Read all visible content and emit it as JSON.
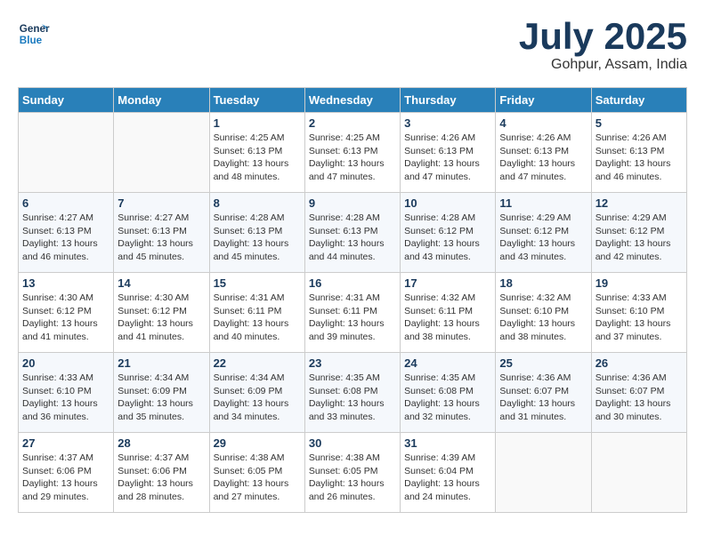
{
  "header": {
    "logo_line1": "General",
    "logo_line2": "Blue",
    "month": "July 2025",
    "location": "Gohpur, Assam, India"
  },
  "days_of_week": [
    "Sunday",
    "Monday",
    "Tuesday",
    "Wednesday",
    "Thursday",
    "Friday",
    "Saturday"
  ],
  "weeks": [
    [
      {
        "day": "",
        "detail": ""
      },
      {
        "day": "",
        "detail": ""
      },
      {
        "day": "1",
        "detail": "Sunrise: 4:25 AM\nSunset: 6:13 PM\nDaylight: 13 hours and 48 minutes."
      },
      {
        "day": "2",
        "detail": "Sunrise: 4:25 AM\nSunset: 6:13 PM\nDaylight: 13 hours and 47 minutes."
      },
      {
        "day": "3",
        "detail": "Sunrise: 4:26 AM\nSunset: 6:13 PM\nDaylight: 13 hours and 47 minutes."
      },
      {
        "day": "4",
        "detail": "Sunrise: 4:26 AM\nSunset: 6:13 PM\nDaylight: 13 hours and 47 minutes."
      },
      {
        "day": "5",
        "detail": "Sunrise: 4:26 AM\nSunset: 6:13 PM\nDaylight: 13 hours and 46 minutes."
      }
    ],
    [
      {
        "day": "6",
        "detail": "Sunrise: 4:27 AM\nSunset: 6:13 PM\nDaylight: 13 hours and 46 minutes."
      },
      {
        "day": "7",
        "detail": "Sunrise: 4:27 AM\nSunset: 6:13 PM\nDaylight: 13 hours and 45 minutes."
      },
      {
        "day": "8",
        "detail": "Sunrise: 4:28 AM\nSunset: 6:13 PM\nDaylight: 13 hours and 45 minutes."
      },
      {
        "day": "9",
        "detail": "Sunrise: 4:28 AM\nSunset: 6:13 PM\nDaylight: 13 hours and 44 minutes."
      },
      {
        "day": "10",
        "detail": "Sunrise: 4:28 AM\nSunset: 6:12 PM\nDaylight: 13 hours and 43 minutes."
      },
      {
        "day": "11",
        "detail": "Sunrise: 4:29 AM\nSunset: 6:12 PM\nDaylight: 13 hours and 43 minutes."
      },
      {
        "day": "12",
        "detail": "Sunrise: 4:29 AM\nSunset: 6:12 PM\nDaylight: 13 hours and 42 minutes."
      }
    ],
    [
      {
        "day": "13",
        "detail": "Sunrise: 4:30 AM\nSunset: 6:12 PM\nDaylight: 13 hours and 41 minutes."
      },
      {
        "day": "14",
        "detail": "Sunrise: 4:30 AM\nSunset: 6:12 PM\nDaylight: 13 hours and 41 minutes."
      },
      {
        "day": "15",
        "detail": "Sunrise: 4:31 AM\nSunset: 6:11 PM\nDaylight: 13 hours and 40 minutes."
      },
      {
        "day": "16",
        "detail": "Sunrise: 4:31 AM\nSunset: 6:11 PM\nDaylight: 13 hours and 39 minutes."
      },
      {
        "day": "17",
        "detail": "Sunrise: 4:32 AM\nSunset: 6:11 PM\nDaylight: 13 hours and 38 minutes."
      },
      {
        "day": "18",
        "detail": "Sunrise: 4:32 AM\nSunset: 6:10 PM\nDaylight: 13 hours and 38 minutes."
      },
      {
        "day": "19",
        "detail": "Sunrise: 4:33 AM\nSunset: 6:10 PM\nDaylight: 13 hours and 37 minutes."
      }
    ],
    [
      {
        "day": "20",
        "detail": "Sunrise: 4:33 AM\nSunset: 6:10 PM\nDaylight: 13 hours and 36 minutes."
      },
      {
        "day": "21",
        "detail": "Sunrise: 4:34 AM\nSunset: 6:09 PM\nDaylight: 13 hours and 35 minutes."
      },
      {
        "day": "22",
        "detail": "Sunrise: 4:34 AM\nSunset: 6:09 PM\nDaylight: 13 hours and 34 minutes."
      },
      {
        "day": "23",
        "detail": "Sunrise: 4:35 AM\nSunset: 6:08 PM\nDaylight: 13 hours and 33 minutes."
      },
      {
        "day": "24",
        "detail": "Sunrise: 4:35 AM\nSunset: 6:08 PM\nDaylight: 13 hours and 32 minutes."
      },
      {
        "day": "25",
        "detail": "Sunrise: 4:36 AM\nSunset: 6:07 PM\nDaylight: 13 hours and 31 minutes."
      },
      {
        "day": "26",
        "detail": "Sunrise: 4:36 AM\nSunset: 6:07 PM\nDaylight: 13 hours and 30 minutes."
      }
    ],
    [
      {
        "day": "27",
        "detail": "Sunrise: 4:37 AM\nSunset: 6:06 PM\nDaylight: 13 hours and 29 minutes."
      },
      {
        "day": "28",
        "detail": "Sunrise: 4:37 AM\nSunset: 6:06 PM\nDaylight: 13 hours and 28 minutes."
      },
      {
        "day": "29",
        "detail": "Sunrise: 4:38 AM\nSunset: 6:05 PM\nDaylight: 13 hours and 27 minutes."
      },
      {
        "day": "30",
        "detail": "Sunrise: 4:38 AM\nSunset: 6:05 PM\nDaylight: 13 hours and 26 minutes."
      },
      {
        "day": "31",
        "detail": "Sunrise: 4:39 AM\nSunset: 6:04 PM\nDaylight: 13 hours and 24 minutes."
      },
      {
        "day": "",
        "detail": ""
      },
      {
        "day": "",
        "detail": ""
      }
    ]
  ]
}
